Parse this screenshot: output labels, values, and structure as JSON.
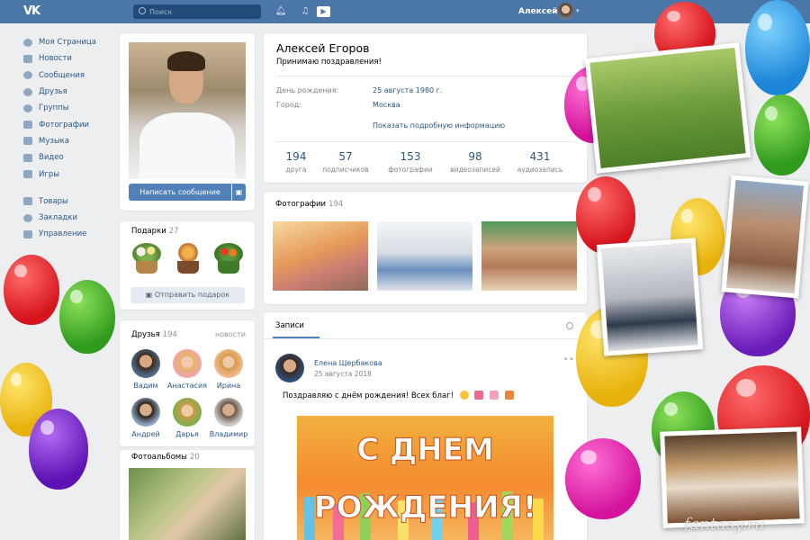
{
  "header": {
    "logo": "VK",
    "search_placeholder": "Поиск",
    "user_name": "Алексей"
  },
  "nav": {
    "items": [
      {
        "label": "Моя Страница",
        "icon": "home-icon"
      },
      {
        "label": "Новости",
        "icon": "news-icon"
      },
      {
        "label": "Сообщения",
        "icon": "messages-icon"
      },
      {
        "label": "Друзья",
        "icon": "friends-icon"
      },
      {
        "label": "Группы",
        "icon": "groups-icon"
      },
      {
        "label": "Фотографии",
        "icon": "camera-icon"
      },
      {
        "label": "Музыка",
        "icon": "music-icon"
      },
      {
        "label": "Видео",
        "icon": "video-icon"
      },
      {
        "label": "Игры",
        "icon": "gamepad-icon"
      }
    ],
    "extra_items": [
      {
        "label": "Товары",
        "icon": "goods-icon"
      },
      {
        "label": "Закладки",
        "icon": "star-icon"
      },
      {
        "label": "Управление",
        "icon": "manage-icon"
      }
    ]
  },
  "profile": {
    "name": "Алексей Егоров",
    "status": "Принимаю поздравления!",
    "send_message": "Написать сообщение",
    "info": [
      {
        "label": "День рождения:",
        "value": "25 августа 1980 г."
      },
      {
        "label": "Город:",
        "value": "Москва"
      }
    ],
    "more_info": "Показать подробную информацию",
    "counters": [
      {
        "num": "194",
        "label": "друга"
      },
      {
        "num": "57",
        "label": "подписчиков"
      },
      {
        "num": "153",
        "label": "фотографии"
      },
      {
        "num": "98",
        "label": "видеозаписей"
      },
      {
        "num": "431",
        "label": "аудиозапись"
      }
    ]
  },
  "gifts": {
    "title": "Подарки",
    "count": "27",
    "send_label": "Отправить подарок"
  },
  "friends": {
    "title": "Друзья",
    "count": "194",
    "news_label": "новости",
    "list": [
      {
        "name": "Вадим"
      },
      {
        "name": "Анастасия"
      },
      {
        "name": "Ирина"
      },
      {
        "name": "Андрей"
      },
      {
        "name": "Дарья"
      },
      {
        "name": "Владимир"
      }
    ]
  },
  "albums": {
    "title": "Фотоальбомы",
    "count": "20"
  },
  "photos": {
    "title": "Фотографии",
    "count": "194"
  },
  "wall": {
    "tab": "Записи",
    "post": {
      "author": "Елена Щербакова",
      "date": "25 августа 2018",
      "text": "Поздравляю с днём рождения! Всех благ!",
      "image_line1": "С ДНЕМ",
      "image_line2": "РОЖДЕНИЯ!"
    }
  },
  "watermark": "fantasy.ru",
  "colors": {
    "header": "#4a76a8",
    "link": "#2a5885",
    "button": "#5181b8",
    "background": "#edeef0"
  }
}
